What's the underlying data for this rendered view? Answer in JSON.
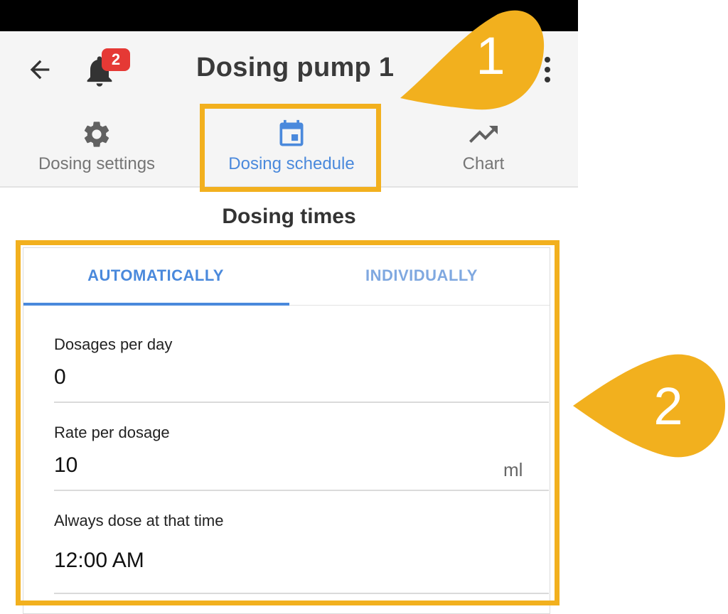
{
  "header": {
    "title": "Dosing pump 1",
    "notification_count": "2"
  },
  "tabs": [
    {
      "label": "Dosing settings",
      "icon": "gear-icon"
    },
    {
      "label": "Dosing schedule",
      "icon": "calendar-icon"
    },
    {
      "label": "Chart",
      "icon": "trending-up-icon"
    }
  ],
  "section": {
    "title": "Dosing times"
  },
  "mode_tabs": [
    {
      "label": "AUTOMATICALLY"
    },
    {
      "label": "INDIVIDUALLY"
    }
  ],
  "fields": [
    {
      "label": "Dosages per day",
      "value": "0",
      "unit": ""
    },
    {
      "label": "Rate per dosage",
      "value": "10",
      "unit": "ml"
    },
    {
      "label": "Always dose at that time",
      "value": "12:00 AM",
      "unit": ""
    }
  ],
  "callouts": {
    "first": "1",
    "second": "2"
  },
  "colors": {
    "accent": "#4a89dc",
    "highlight": "#f2b01e",
    "badge": "#e53935"
  }
}
